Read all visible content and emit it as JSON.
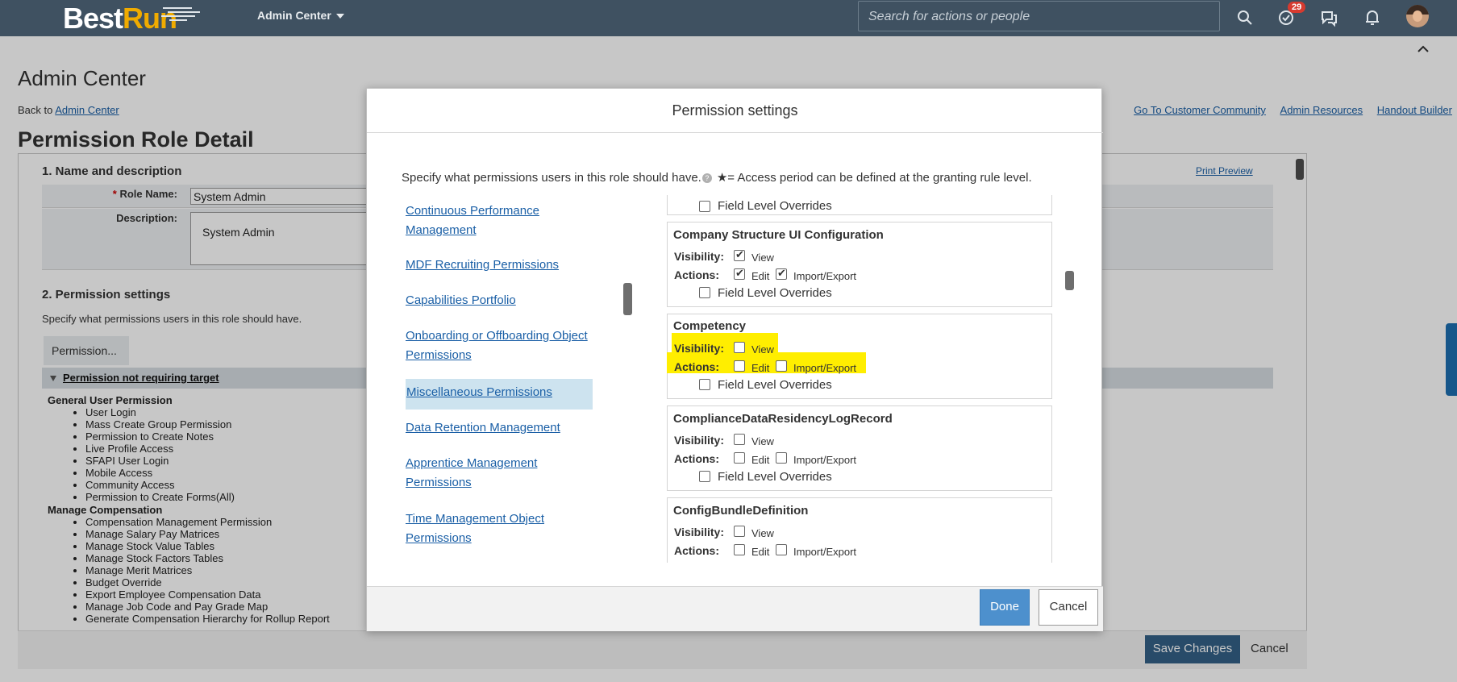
{
  "shell": {
    "logo_best": "Best",
    "logo_run": "Run",
    "menu_label": "Admin Center",
    "search_placeholder": "Search for actions or people",
    "badge_count": "29"
  },
  "page": {
    "admin_title": "Admin Center",
    "back_prefix": "Back to",
    "back_link": "Admin Center",
    "role_detail_title": "Permission Role Detail",
    "top_links": [
      "Go To Customer Community",
      "Admin Resources",
      "Handout Builder"
    ],
    "print_preview": "Print Preview",
    "section1_title": "1. Name and description",
    "role_name_label": "Role Name:",
    "role_name_value": "System Admin",
    "description_label": "Description:",
    "description_value": "System Admin",
    "section2_title": "2. Permission settings",
    "section2_text": "Specify what permissions users in this role should have.",
    "permission_button": "Permission...",
    "group_bar_label": "Permission not requiring target",
    "group1_title": "General User Permission",
    "group1_items": [
      "User Login",
      "Mass Create Group Permission",
      "Permission to Create Notes",
      "Live Profile Access",
      "SFAPI User Login",
      "Mobile Access",
      "Community Access",
      "Permission to Create Forms(All)"
    ],
    "group2_title": "Manage Compensation",
    "group2_items": [
      "Compensation Management Permission",
      "Manage Salary Pay Matrices",
      "Manage Stock Value Tables",
      "Manage Stock Factors Tables",
      "Manage Merit Matrices",
      "Budget Override",
      "Export Employee Compensation Data",
      "Manage Job Code and Pay Grade Map",
      "Generate Compensation Hierarchy for Rollup Report"
    ],
    "save_changes": "Save Changes",
    "cancel": "Cancel"
  },
  "dialog": {
    "title": "Permission settings",
    "intro_text": "Specify what permissions users in this role should have.",
    "intro_note": "★= Access period can be defined at the granting rule level.",
    "nav_items": [
      {
        "line1": "Continuous Performance",
        "line2": "Management",
        "active": false
      },
      {
        "line1": "MDF Recruiting Permissions",
        "line2": "",
        "active": false
      },
      {
        "line1": "Capabilities Portfolio",
        "line2": "",
        "active": false
      },
      {
        "line1": "Onboarding or Offboarding Object",
        "line2": "Permissions",
        "active": false
      },
      {
        "line1": "Miscellaneous Permissions",
        "line2": "",
        "active": true
      },
      {
        "line1": "Data Retention Management",
        "line2": "",
        "active": false
      },
      {
        "line1": "Apprentice Management",
        "line2": "Permissions",
        "active": false
      },
      {
        "line1": "Time Management Object",
        "line2": "Permissions",
        "active": false
      }
    ],
    "labels": {
      "visibility": "Visibility:",
      "actions": "Actions:",
      "view": "View",
      "edit": "Edit",
      "import_export": "Import/Export",
      "field_level_overrides": "Field Level Overrides"
    },
    "cards": [
      {
        "title": "Company Structure UI Configuration",
        "view": true,
        "edit": true,
        "import_export": true,
        "flo": false,
        "highlighted": false
      },
      {
        "title": "Competency",
        "view": false,
        "edit": false,
        "import_export": false,
        "flo": false,
        "highlighted": true
      },
      {
        "title": "ComplianceDataResidencyLogRecord",
        "view": false,
        "edit": false,
        "import_export": false,
        "flo": false,
        "highlighted": false
      },
      {
        "title": "ConfigBundleDefinition",
        "view": false,
        "edit": false,
        "import_export": false,
        "flo": false,
        "highlighted": false
      }
    ],
    "done": "Done",
    "cancel": "Cancel"
  },
  "colors": {
    "shell_bg": "#3f5161",
    "brand_orange": "#f0ab00",
    "link": "#1a5fa6",
    "primary_button": "#4d90cd",
    "highlight": "#ffee00",
    "active_nav": "#cde3ef"
  }
}
